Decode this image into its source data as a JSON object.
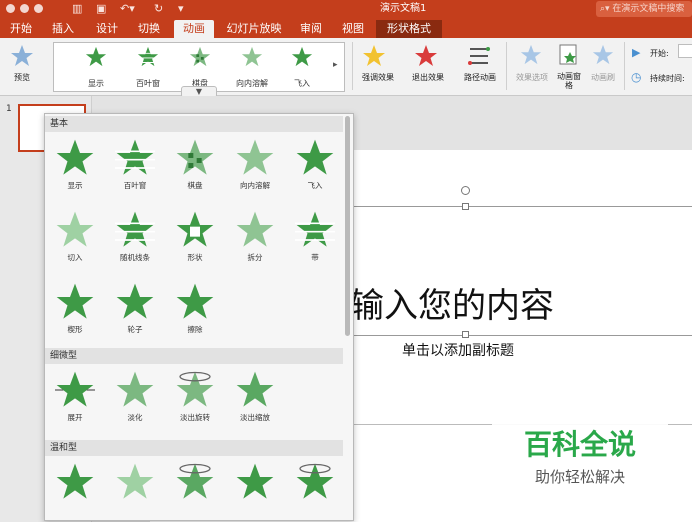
{
  "window": {
    "title": "演示文稿1",
    "search_placeholder": "在演示文稿中搜索"
  },
  "tabs": [
    "开始",
    "插入",
    "设计",
    "切换",
    "动画",
    "幻灯片放映",
    "审阅",
    "视图",
    "形状格式"
  ],
  "ribbon": {
    "preview_label": "预览",
    "gallery": [
      "显示",
      "百叶窗",
      "棋盘",
      "向内溶解",
      "飞入"
    ],
    "emphasis_label": "强调效果",
    "exit_label": "退出效果",
    "path_label": "路径动画",
    "options_label": "效果选项",
    "pane_label": "动画窗格",
    "painter_label": "动画刷",
    "start_label": "开始:",
    "duration_label": "持续时间:"
  },
  "thumbnail": {
    "number": "1"
  },
  "slide": {
    "title": "输入您的内容",
    "subtitle": "单击以添加副标题"
  },
  "dropdown": {
    "sections": [
      {
        "header": "基本",
        "effects": [
          "显示",
          "百叶窗",
          "棋盘",
          "向内溶解",
          "飞入",
          "切入",
          "随机线条",
          "形状",
          "拆分",
          "带",
          "楔形",
          "轮子",
          "擦除"
        ]
      },
      {
        "header": "细微型",
        "effects": [
          "展开",
          "淡化",
          "淡出旋转",
          "淡出缩放"
        ]
      },
      {
        "header": "温和型",
        "effects": [
          "",
          "",
          "",
          "",
          ""
        ]
      }
    ]
  },
  "watermark": {
    "title": "百科全说",
    "subtitle": "助你轻松解决"
  },
  "colors": {
    "accent": "#c43e1c",
    "star_green": "#3e9a46",
    "emphasis_star": "#f2c230",
    "exit_star": "#d93b3b"
  }
}
